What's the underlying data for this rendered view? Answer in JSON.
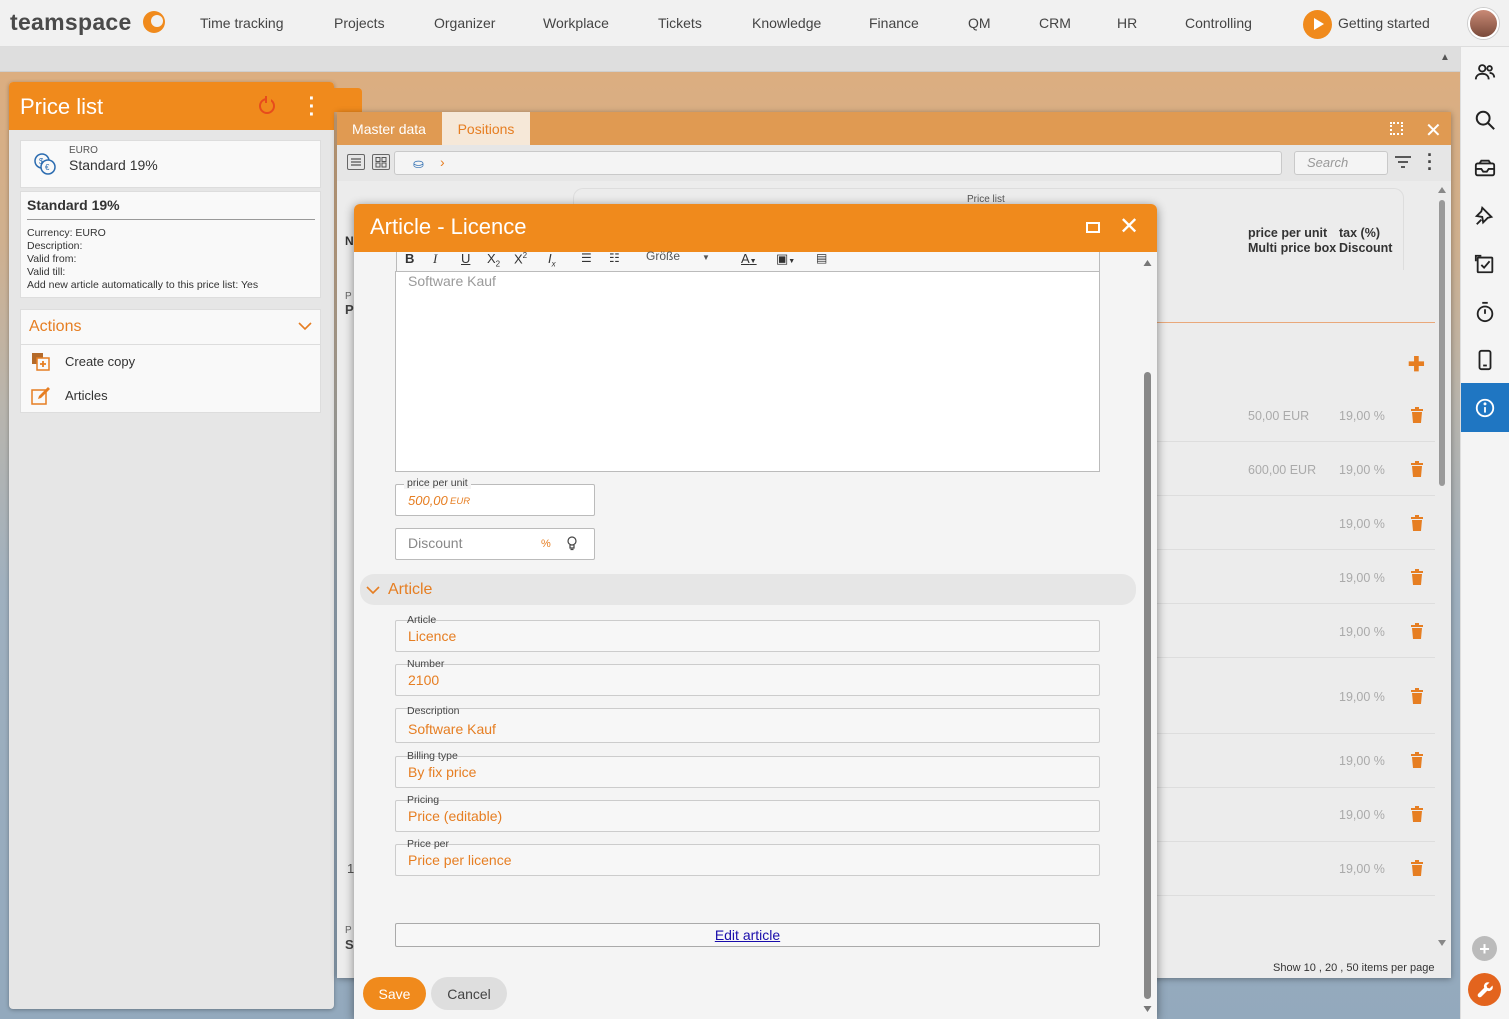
{
  "app": {
    "logo": "teamspace",
    "nav": [
      "Time tracking",
      "Projects",
      "Organizer",
      "Workplace",
      "Tickets",
      "Knowledge",
      "Finance",
      "QM",
      "CRM",
      "HR",
      "Controlling"
    ],
    "getting_started": "Getting started"
  },
  "icons": {
    "right_sidebar": [
      "people-icon",
      "search-icon",
      "inbox-icon",
      "pin-icon",
      "task-check-icon",
      "stopwatch-icon",
      "mobile-icon",
      "info-icon"
    ],
    "bottom": [
      "plus-circle-icon",
      "wrench-icon"
    ]
  },
  "colors": {
    "accent": "#f08a1c",
    "accent_text": "#e67e22",
    "active_sidebar": "#1f76c2",
    "link": "#1a0dab"
  },
  "left_panel": {
    "title": "Price list",
    "card": {
      "currency_label": "EURO",
      "name": "Standard 19%"
    },
    "details": {
      "title": "Standard 19%",
      "rows": [
        "Currency: EURO",
        "Description:",
        "Valid from:",
        "Valid till:",
        "Add new article automatically to this price list: Yes"
      ]
    },
    "actions": {
      "title": "Actions",
      "items": [
        "Create copy",
        "Articles"
      ]
    }
  },
  "window": {
    "tabs": [
      "Master data",
      "Positions"
    ],
    "active_tab": "Positions",
    "search_placeholder": "Search",
    "price_list_label": "Price list",
    "col_n": "N",
    "col_ppu_line1": "price per unit",
    "col_ppu_line2": "Multi price box",
    "col_tax_line1": "tax (%)",
    "col_tax_line2": "Discount",
    "group_p_small": "P",
    "group_p": "P",
    "row_1_label": "1",
    "group_s_small": "P",
    "group_s": "S",
    "rows": [
      {
        "price": "50,00 EUR",
        "tax": "19,00 %"
      },
      {
        "price": "600,00 EUR",
        "tax": "19,00 %"
      },
      {
        "price": "",
        "tax": "19,00 %"
      },
      {
        "price": "",
        "tax": "19,00 %"
      },
      {
        "price": "",
        "tax": "19,00 %"
      },
      {
        "price": "",
        "tax": "19,00 %"
      },
      {
        "price": "",
        "tax": "19,00 %"
      },
      {
        "price": "",
        "tax": "19,00 %"
      },
      {
        "price": "",
        "tax": "19,00 %"
      }
    ],
    "pager": "Show 10 , 20 , 50 items per page"
  },
  "dialog": {
    "title": "Article - Licence",
    "rte": {
      "bold": "B",
      "italic": "I",
      "underline": "U",
      "size_label": "Größe",
      "editor_text": "Software Kauf"
    },
    "price_per_unit": {
      "label": "price per unit",
      "value": "500,00",
      "unit": "EUR"
    },
    "discount": {
      "placeholder": "Discount",
      "unit": "%"
    },
    "article_section_title": "Article",
    "fields": [
      {
        "label": "Article",
        "value": "Licence"
      },
      {
        "label": "Number",
        "value": "2100"
      },
      {
        "label": "Description",
        "value": "Software Kauf"
      },
      {
        "label": "Billing type",
        "value": "By fix price"
      },
      {
        "label": "Pricing",
        "value": "Price (editable)"
      },
      {
        "label": "Price per",
        "value": "Price per licence"
      }
    ],
    "edit_article": "Edit article",
    "save": "Save",
    "cancel": "Cancel"
  }
}
